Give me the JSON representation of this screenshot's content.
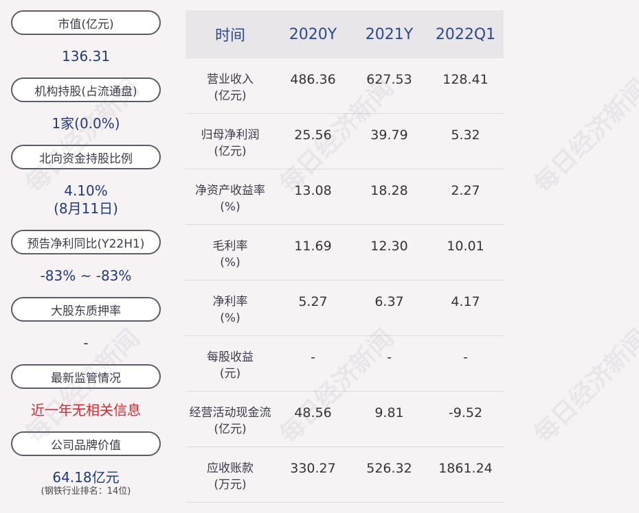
{
  "left_panel": [
    {
      "label": "市值(亿元)",
      "value": "136.31"
    },
    {
      "label": "机构持股(占流通盘)",
      "value": "1家(0.0%)"
    },
    {
      "label": "北向资金持股比例",
      "value": "4.10%",
      "value2": "(8月11日)"
    },
    {
      "label": "预告净利同比(Y22H1)",
      "value": "-83% ~ -83%"
    },
    {
      "label": "大股东质押率",
      "value": "-"
    },
    {
      "label": "最新监管情况",
      "value": "近一年无相关信息"
    },
    {
      "label": "公司品牌价值",
      "value": "64.18亿元",
      "note": "(钢铁行业排名：14位)"
    }
  ],
  "table": {
    "headers": [
      "时间",
      "2020Y",
      "2021Y",
      "2022Q1"
    ],
    "rows": [
      {
        "l1": "营业收入",
        "l2": "(亿元)",
        "v": [
          "486.36",
          "627.53",
          "128.41"
        ]
      },
      {
        "l1": "归母净利润",
        "l2": "(亿元)",
        "v": [
          "25.56",
          "39.79",
          "5.32"
        ]
      },
      {
        "l1": "净资产收益率",
        "l2": "(%)",
        "v": [
          "13.08",
          "18.28",
          "2.27"
        ]
      },
      {
        "l1": "毛利率",
        "l2": "(%)",
        "v": [
          "11.69",
          "12.30",
          "10.01"
        ]
      },
      {
        "l1": "净利率",
        "l2": "(%)",
        "v": [
          "5.27",
          "6.37",
          "4.17"
        ]
      },
      {
        "l1": "每股收益",
        "l2": "(元)",
        "v": [
          "-",
          "-",
          "-"
        ]
      },
      {
        "l1": "经营活动现金流",
        "l2": "(亿元)",
        "v": [
          "48.56",
          "9.81",
          "-9.52"
        ]
      },
      {
        "l1": "应收账款",
        "l2": "(万元)",
        "v": [
          "330.27",
          "526.32",
          "1861.24"
        ]
      }
    ]
  },
  "watermark": "每日经济新闻",
  "colors": {
    "value_blue": "#1f3a7a",
    "alert_red": "#d8282e",
    "header_bg": "#e9e6ea"
  }
}
